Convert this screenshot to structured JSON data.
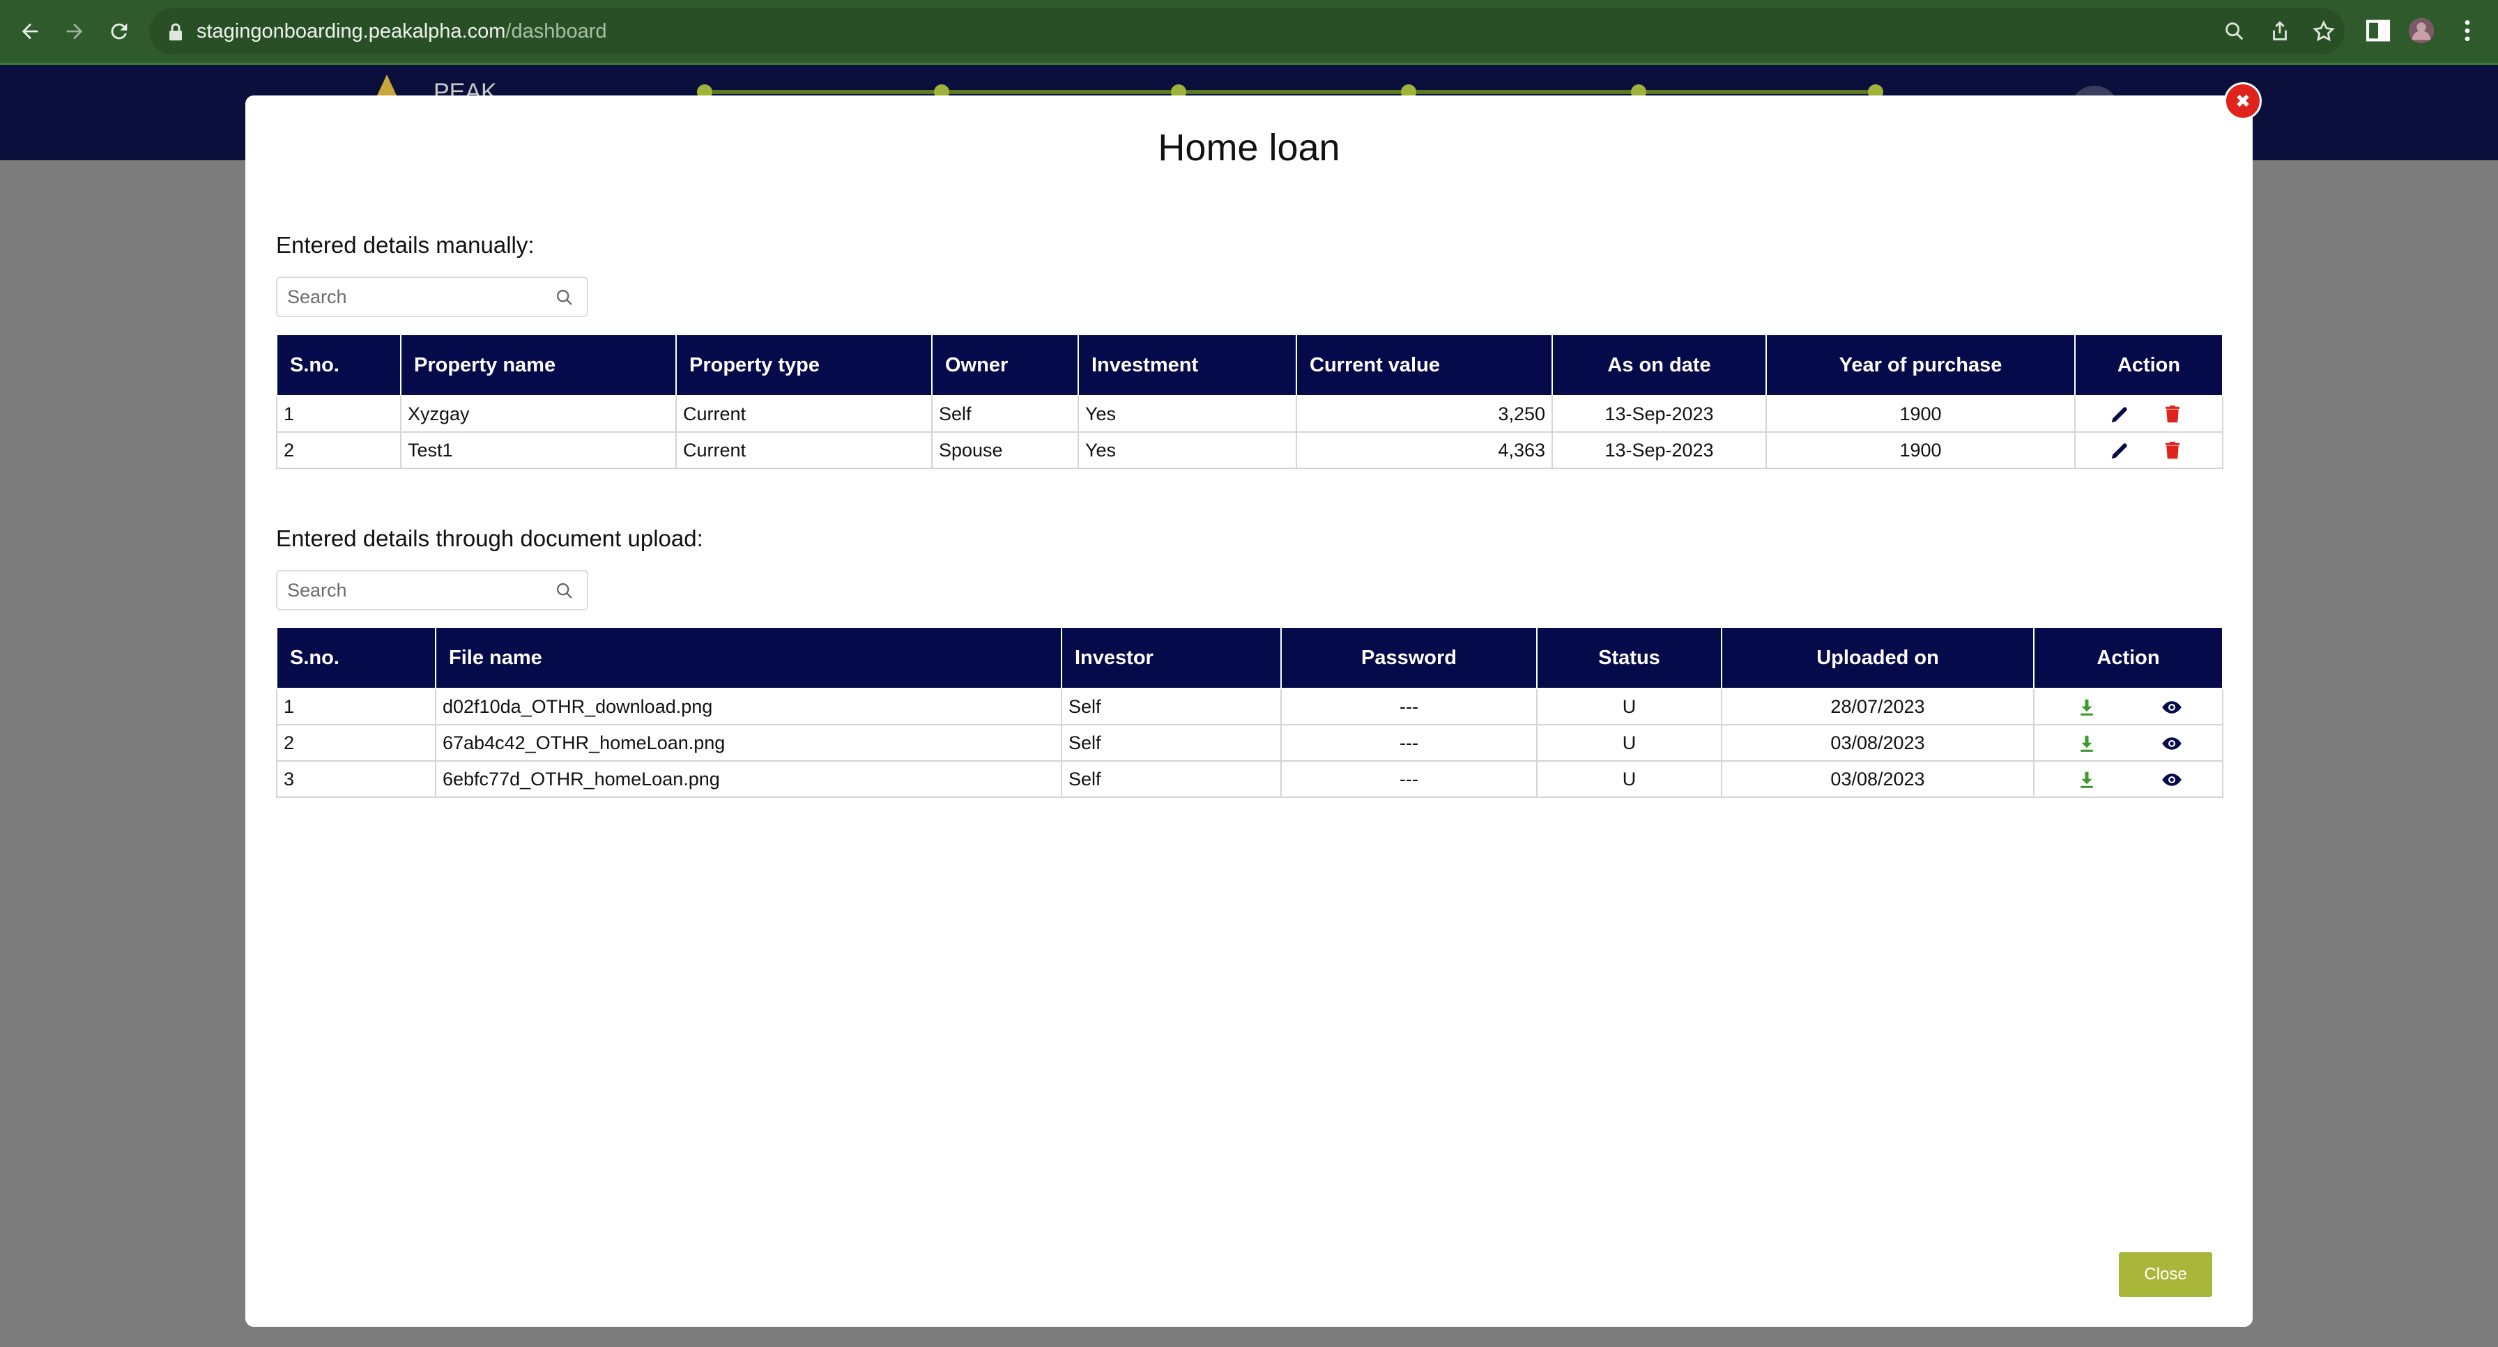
{
  "browser": {
    "url_host": "stagingonboarding.peakalpha.com",
    "url_path": "/dashboard"
  },
  "app_header": {
    "logo_text": "PEAK"
  },
  "modal": {
    "title": "Home loan",
    "close_button_label": "Close",
    "manual_section": {
      "label": "Entered details manually:",
      "search_placeholder": "Search",
      "columns": [
        "S.no.",
        "Property name",
        "Property type",
        "Owner",
        "Investment",
        "Current value",
        "As on date",
        "Year of purchase",
        "Action"
      ],
      "rows": [
        {
          "sno": "1",
          "property_name": "Xyzgay",
          "property_type": "Current",
          "owner": "Self",
          "investment": "Yes",
          "current_value": "3,250",
          "as_on_date": "13-Sep-2023",
          "year_of_purchase": "1900"
        },
        {
          "sno": "2",
          "property_name": "Test1",
          "property_type": "Current",
          "owner": "Spouse",
          "investment": "Yes",
          "current_value": "4,363",
          "as_on_date": "13-Sep-2023",
          "year_of_purchase": "1900"
        }
      ]
    },
    "upload_section": {
      "label": "Entered details through document upload:",
      "search_placeholder": "Search",
      "columns": [
        "S.no.",
        "File name",
        "Investor",
        "Password",
        "Status",
        "Uploaded on",
        "Action"
      ],
      "rows": [
        {
          "sno": "1",
          "file_name": "d02f10da_OTHR_download.png",
          "investor": "Self",
          "password": "---",
          "status": "U",
          "uploaded_on": "28/07/2023"
        },
        {
          "sno": "2",
          "file_name": "67ab4c42_OTHR_homeLoan.png",
          "investor": "Self",
          "password": "---",
          "status": "U",
          "uploaded_on": "03/08/2023"
        },
        {
          "sno": "3",
          "file_name": "6ebfc77d_OTHR_homeLoan.png",
          "investor": "Self",
          "password": "---",
          "status": "U",
          "uploaded_on": "03/08/2023"
        }
      ]
    }
  },
  "colors": {
    "table_header_bg": "#050a4a",
    "close_button_bg": "#a8b73a",
    "delete_icon": "#e0231c",
    "download_icon": "#3d9a2e",
    "modal_close_x": "#e0231c"
  },
  "icons": {
    "edit": "pencil-icon",
    "delete": "trash-icon",
    "download": "download-icon",
    "view": "eye-icon",
    "search": "search-icon"
  }
}
